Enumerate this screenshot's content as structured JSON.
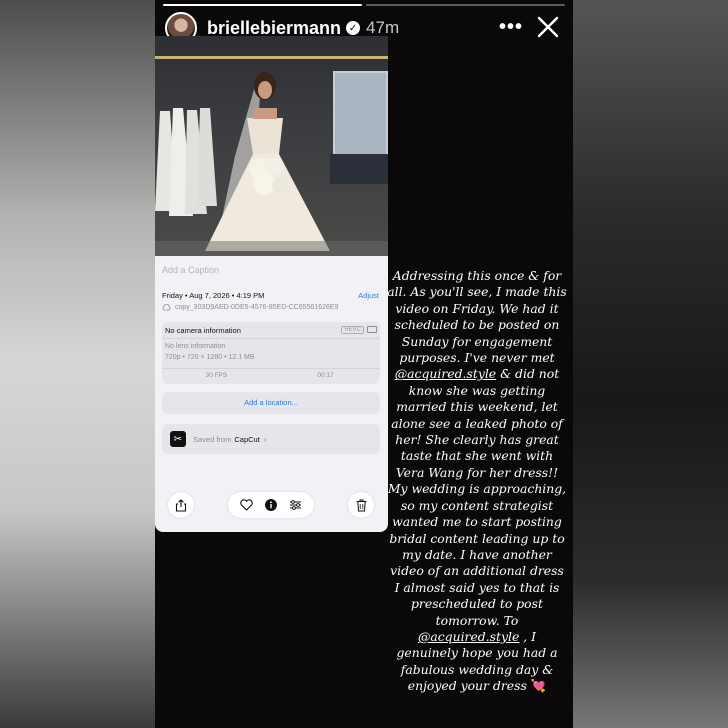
{
  "story": {
    "username": "briellebiermann",
    "time_ago": "47m",
    "progress_segments": 2,
    "progress_active": 1
  },
  "screenshot": {
    "caption_placeholder": "Add a Caption",
    "date": "Friday • Aug 7, 2026 • 4:19 PM",
    "adjust_label": "Adjust",
    "filename": "copy_303D9AED-0DE5-4576-85ED-CC65561626E9",
    "camera_info": "No camera information",
    "format_badge": "HEVC",
    "lens_info": "No lens information",
    "specs": "720p • 720 × 1280 • 12.1 MB",
    "fps": "30 FPS",
    "duration": "00:17",
    "location_button": "Add a location...",
    "saved_from_label": "Saved from",
    "saved_from_app": "CapCut"
  },
  "text": {
    "part1": "Addressing this once & for all. As you'll see, I made this video on Friday. We had it scheduled to be posted on Sunday for engagement purposes. I've never met",
    "mention1": "@acquired.style",
    "part2": "& did not know she was getting married this weekend, let alone see a leaked photo of her! She clearly has great taste that she went with Vera Wang for her dress!! My wedding is approaching, so my content strategist wanted me to start posting bridal content leading up to my date. I have another video of an additional dress I almost said yes to that is prescheduled to post tomorrow. To",
    "mention2": "@acquired.style",
    "part3": ", I genuinely hope you had a fabulous wedding day & enjoyed your dress",
    "emoji": "💘"
  },
  "icons": {
    "verified": "verified-badge-icon",
    "more": "more-options-icon",
    "close": "close-icon",
    "share": "share-icon",
    "favorite": "heart-icon",
    "info": "info-icon",
    "adjust": "adjust-sliders-icon",
    "delete": "trash-icon"
  },
  "colors": {
    "story_bg": "#0a0808",
    "link_blue": "#2c7be5",
    "panel_bg": "#f2f2f6"
  }
}
